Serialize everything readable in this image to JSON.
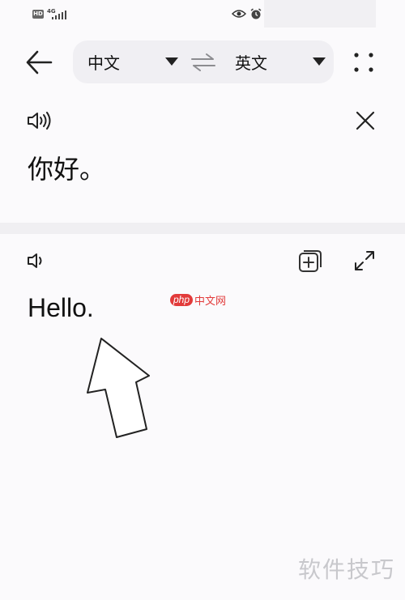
{
  "status_bar": {
    "hd_badge": "HD",
    "network": "4G",
    "icons": [
      "signal-icon",
      "eye-icon",
      "alarm-icon"
    ]
  },
  "top_bar": {
    "back_icon": "arrow-left-icon",
    "source_language": "中文",
    "target_language": "英文",
    "swap_icon": "swap-icon",
    "more_icon": "more-dots-icon"
  },
  "source": {
    "speaker_icon": "speaker-icon",
    "clear_icon": "close-icon",
    "text": "你好。"
  },
  "result": {
    "speaker_icon": "speaker-icon",
    "copy_icon": "copy-icon",
    "expand_icon": "expand-icon",
    "text": "Hello."
  },
  "watermarks": {
    "php_logo": "php",
    "php_site": "中文网",
    "bottom": "软件技巧"
  },
  "colors": {
    "background": "#fbfafc",
    "pill": "#f0eff3",
    "watermark_red": "#e23b3b",
    "watermark_gray": "#c8c8cc"
  }
}
